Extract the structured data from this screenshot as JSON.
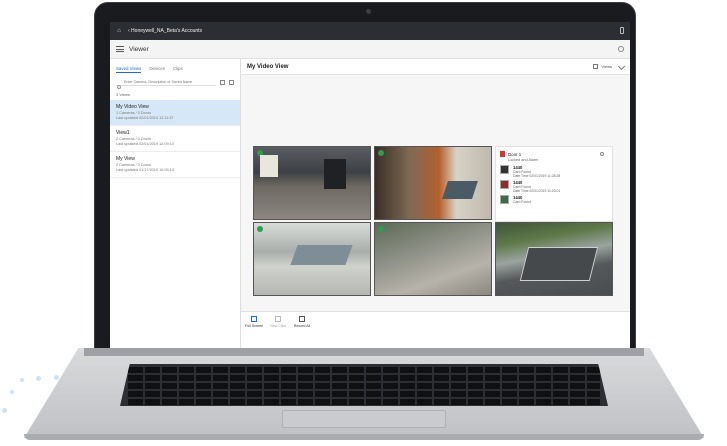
{
  "topbar": {
    "home_icon": "home-icon",
    "account": "‹ Honeywell_NA_Beta's Accounts"
  },
  "appbar": {
    "title": "Viewer"
  },
  "sidebar": {
    "tabs": [
      {
        "label": "Saved Views",
        "active": true
      },
      {
        "label": "Devices"
      },
      {
        "label": "Clips"
      }
    ],
    "search_placeholder": "Enter Camera, Description or Saved Name",
    "count": "3 Views",
    "views": [
      {
        "name": "My Video View",
        "cameras": "1 Cameras / 0 Doors",
        "updated": "Last updated 02/01/2019 12:11:37",
        "selected": true
      },
      {
        "name": "View1",
        "cameras": "2 Cameras / 0 Doors",
        "updated": "Last updated 02/01/2019 12:09:10"
      },
      {
        "name": "My View",
        "cameras": "2 Cameras / 0 Doors",
        "updated": "Last updated 01/17/2019 10:05:14"
      }
    ]
  },
  "main": {
    "title": "My Video View",
    "views_label": "Views",
    "events": {
      "door": "Door 1",
      "status": "Locked and Alarm",
      "items": [
        {
          "number": "1440",
          "type": "Card Found",
          "time": "Date Time 02/01/2019 11:28:28"
        },
        {
          "number": "1440",
          "type": "Card Found",
          "time": "Date Time 02/01/2019 11:23:01"
        },
        {
          "number": "1440",
          "type": "Card Found",
          "time": ""
        }
      ]
    }
  },
  "bottombar": {
    "tools": [
      {
        "label": "Full Screen",
        "enabled": true
      },
      {
        "label": "View Clips",
        "enabled": false
      },
      {
        "label": "Record All",
        "enabled": true
      }
    ]
  },
  "colors": {
    "accent": "#1c6fd1",
    "topbar": "#2b2e33",
    "selected_row": "#d6e8f7",
    "live_badge": "#2e9e4a"
  }
}
